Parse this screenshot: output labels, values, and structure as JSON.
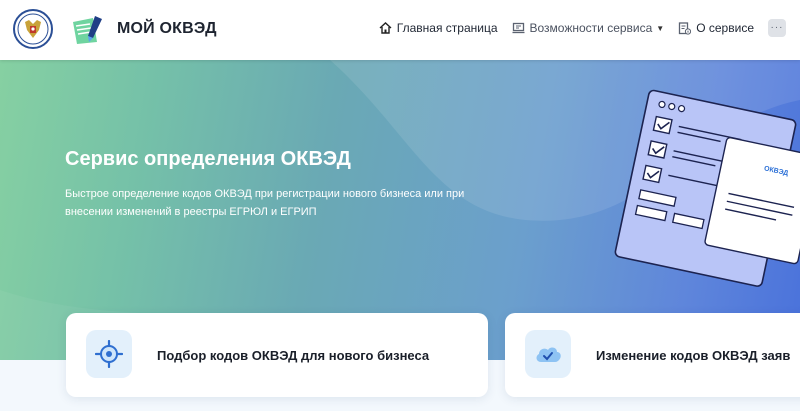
{
  "header": {
    "brand": "МОЙ ОКВЭД",
    "nav": [
      {
        "label": "Главная страница",
        "icon": "home-icon"
      },
      {
        "label": "Возможности сервиса",
        "icon": "monitor-icon",
        "has_dropdown": true
      },
      {
        "label": "О сервисе",
        "icon": "document-info-icon"
      }
    ],
    "more_label": "···"
  },
  "hero": {
    "title": "Сервис определения ОКВЭД",
    "subtitle": "Быстрое определение кодов ОКВЭД при регистрации нового бизнеса или при внесении изменений в реестры ЕГРЮЛ и ЕГРИП",
    "illustration_label": "ОКВЭД"
  },
  "cards": [
    {
      "title": "Подбор кодов ОКВЭД для нового бизнеса",
      "icon": "target-icon"
    },
    {
      "title": "Изменение кодов ОКВЭД заяв",
      "icon": "cloud-check-icon"
    }
  ],
  "colors": {
    "hero_start": "#86d0a2",
    "hero_end": "#4a72db",
    "icon_bg": "#e3f0fb",
    "icon_accent": "#3a8fe0"
  }
}
